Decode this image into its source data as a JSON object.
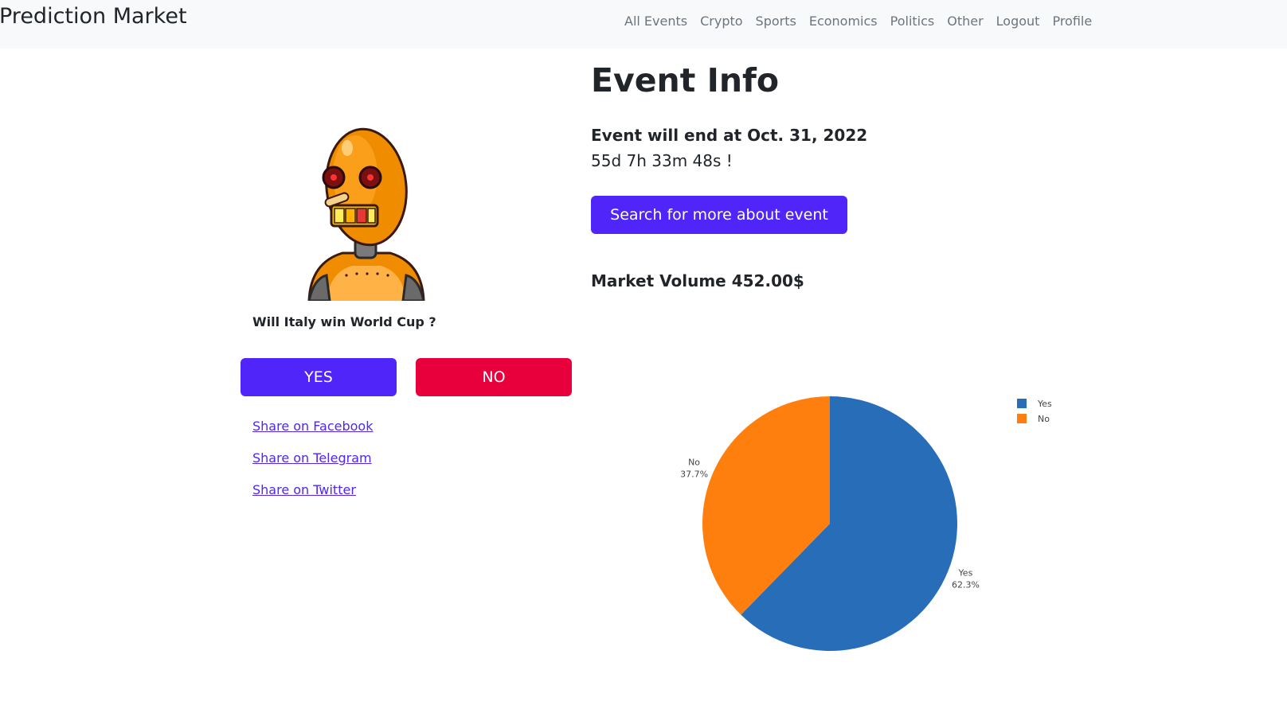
{
  "navbar": {
    "brand": "Prediction Market",
    "links": [
      "All Events",
      "Crypto",
      "Sports",
      "Economics",
      "Politics",
      "Other",
      "Logout",
      "Profile"
    ]
  },
  "event": {
    "question": "Will Italy win World Cup ?",
    "yes_label": "YES",
    "no_label": "NO",
    "share_links": [
      "Share on Facebook",
      "Share on Telegram",
      "Share on Twitter"
    ],
    "info_title": "Event Info",
    "end_text": "Event will end at Oct. 31, 2022",
    "countdown": "55d 7h 33m 48s !",
    "search_button": "Search for more about event",
    "volume_label": "Market Volume",
    "volume_value": "452.00$"
  },
  "colors": {
    "primary": "#4f25fa",
    "danger": "#e8003d",
    "yes_slice": "#276db8",
    "no_slice": "#ff7f0e"
  },
  "chart_data": {
    "type": "pie",
    "slices": [
      {
        "label": "Yes",
        "value": 62.3,
        "text": "62.3%",
        "color": "#276db8"
      },
      {
        "label": "No",
        "value": 37.7,
        "text": "37.7%",
        "color": "#ff7f0e"
      }
    ],
    "legend_position": "top-right"
  }
}
